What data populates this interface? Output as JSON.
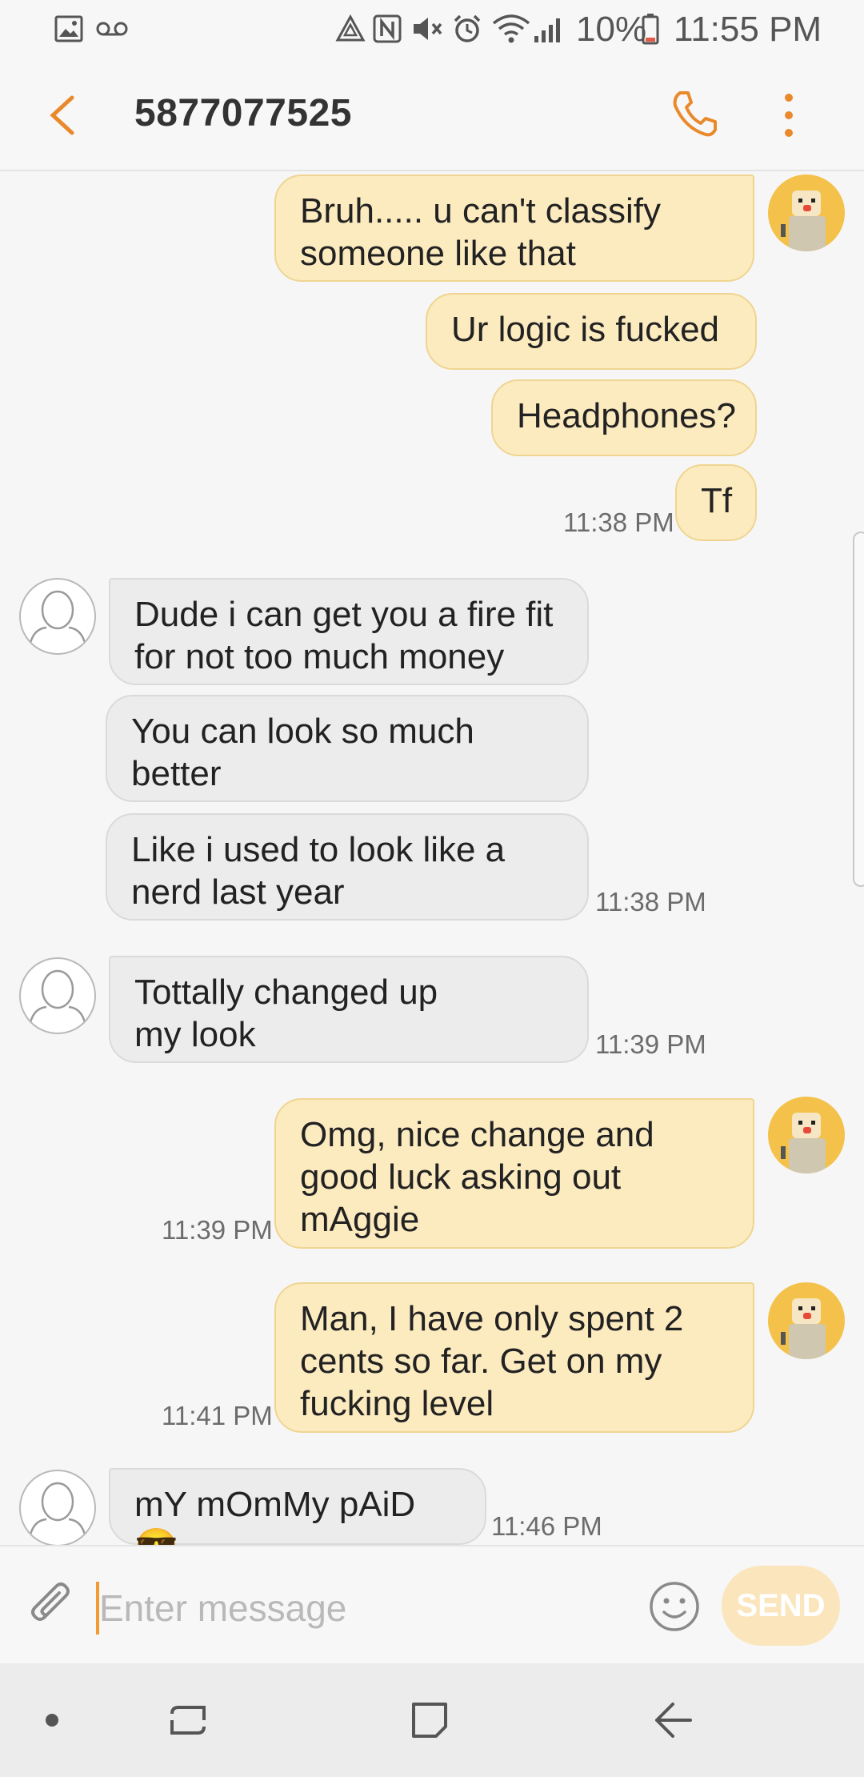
{
  "status_bar": {
    "battery": "10%",
    "time": "11:55 PM",
    "icons": [
      "image-icon",
      "voicemail-icon",
      "data-saver-icon",
      "nfc-icon",
      "mute-icon",
      "alarm-icon",
      "wifi-icon",
      "signal-icon",
      "battery-icon"
    ]
  },
  "header": {
    "title": "5877077525",
    "back_icon": "back-arrow-icon",
    "call_icon": "phone-icon",
    "more_icon": "more-vertical-icon",
    "accent_color": "#e9892b"
  },
  "messages": [
    {
      "direction": "out",
      "text_lines": [
        "Bruh..... u can't classify",
        "someone like that"
      ],
      "timestamp": ""
    },
    {
      "direction": "out",
      "text_lines": [
        "Ur logic is fucked"
      ],
      "timestamp": ""
    },
    {
      "direction": "out",
      "text_lines": [
        "Headphones?"
      ],
      "timestamp": ""
    },
    {
      "direction": "out",
      "text_lines": [
        "Tf"
      ],
      "timestamp": "11:38 PM"
    },
    {
      "direction": "in",
      "text_lines": [
        "Dude i can get you a fire fit",
        "for not too much money"
      ],
      "timestamp": ""
    },
    {
      "direction": "in",
      "text_lines": [
        "You can look so much",
        "better"
      ],
      "timestamp": ""
    },
    {
      "direction": "in",
      "text_lines": [
        "Like i used to look like a",
        "nerd last year"
      ],
      "timestamp": "11:38 PM"
    },
    {
      "direction": "in",
      "text_lines": [
        "Tottally changed up",
        "my look"
      ],
      "timestamp": "11:39 PM"
    },
    {
      "direction": "out",
      "text_lines": [
        "Omg, nice change and",
        "good luck asking out",
        "mAggie"
      ],
      "timestamp": "11:39 PM"
    },
    {
      "direction": "out",
      "text_lines": [
        "Man, I have only spent 2",
        "cents so far. Get on my",
        "fucking level"
      ],
      "timestamp": "11:41 PM"
    },
    {
      "direction": "in",
      "text_lines": [
        "mY mOmMy pAiD 😎"
      ],
      "timestamp": "11:46 PM"
    }
  ],
  "composer": {
    "placeholder": "Enter message",
    "send_label": "SEND",
    "attach_icon": "paperclip-icon",
    "emoji_icon": "smiley-icon"
  },
  "nav_bar": {
    "icons": [
      "dot-icon",
      "recents-icon",
      "home-icon",
      "back-icon"
    ]
  }
}
